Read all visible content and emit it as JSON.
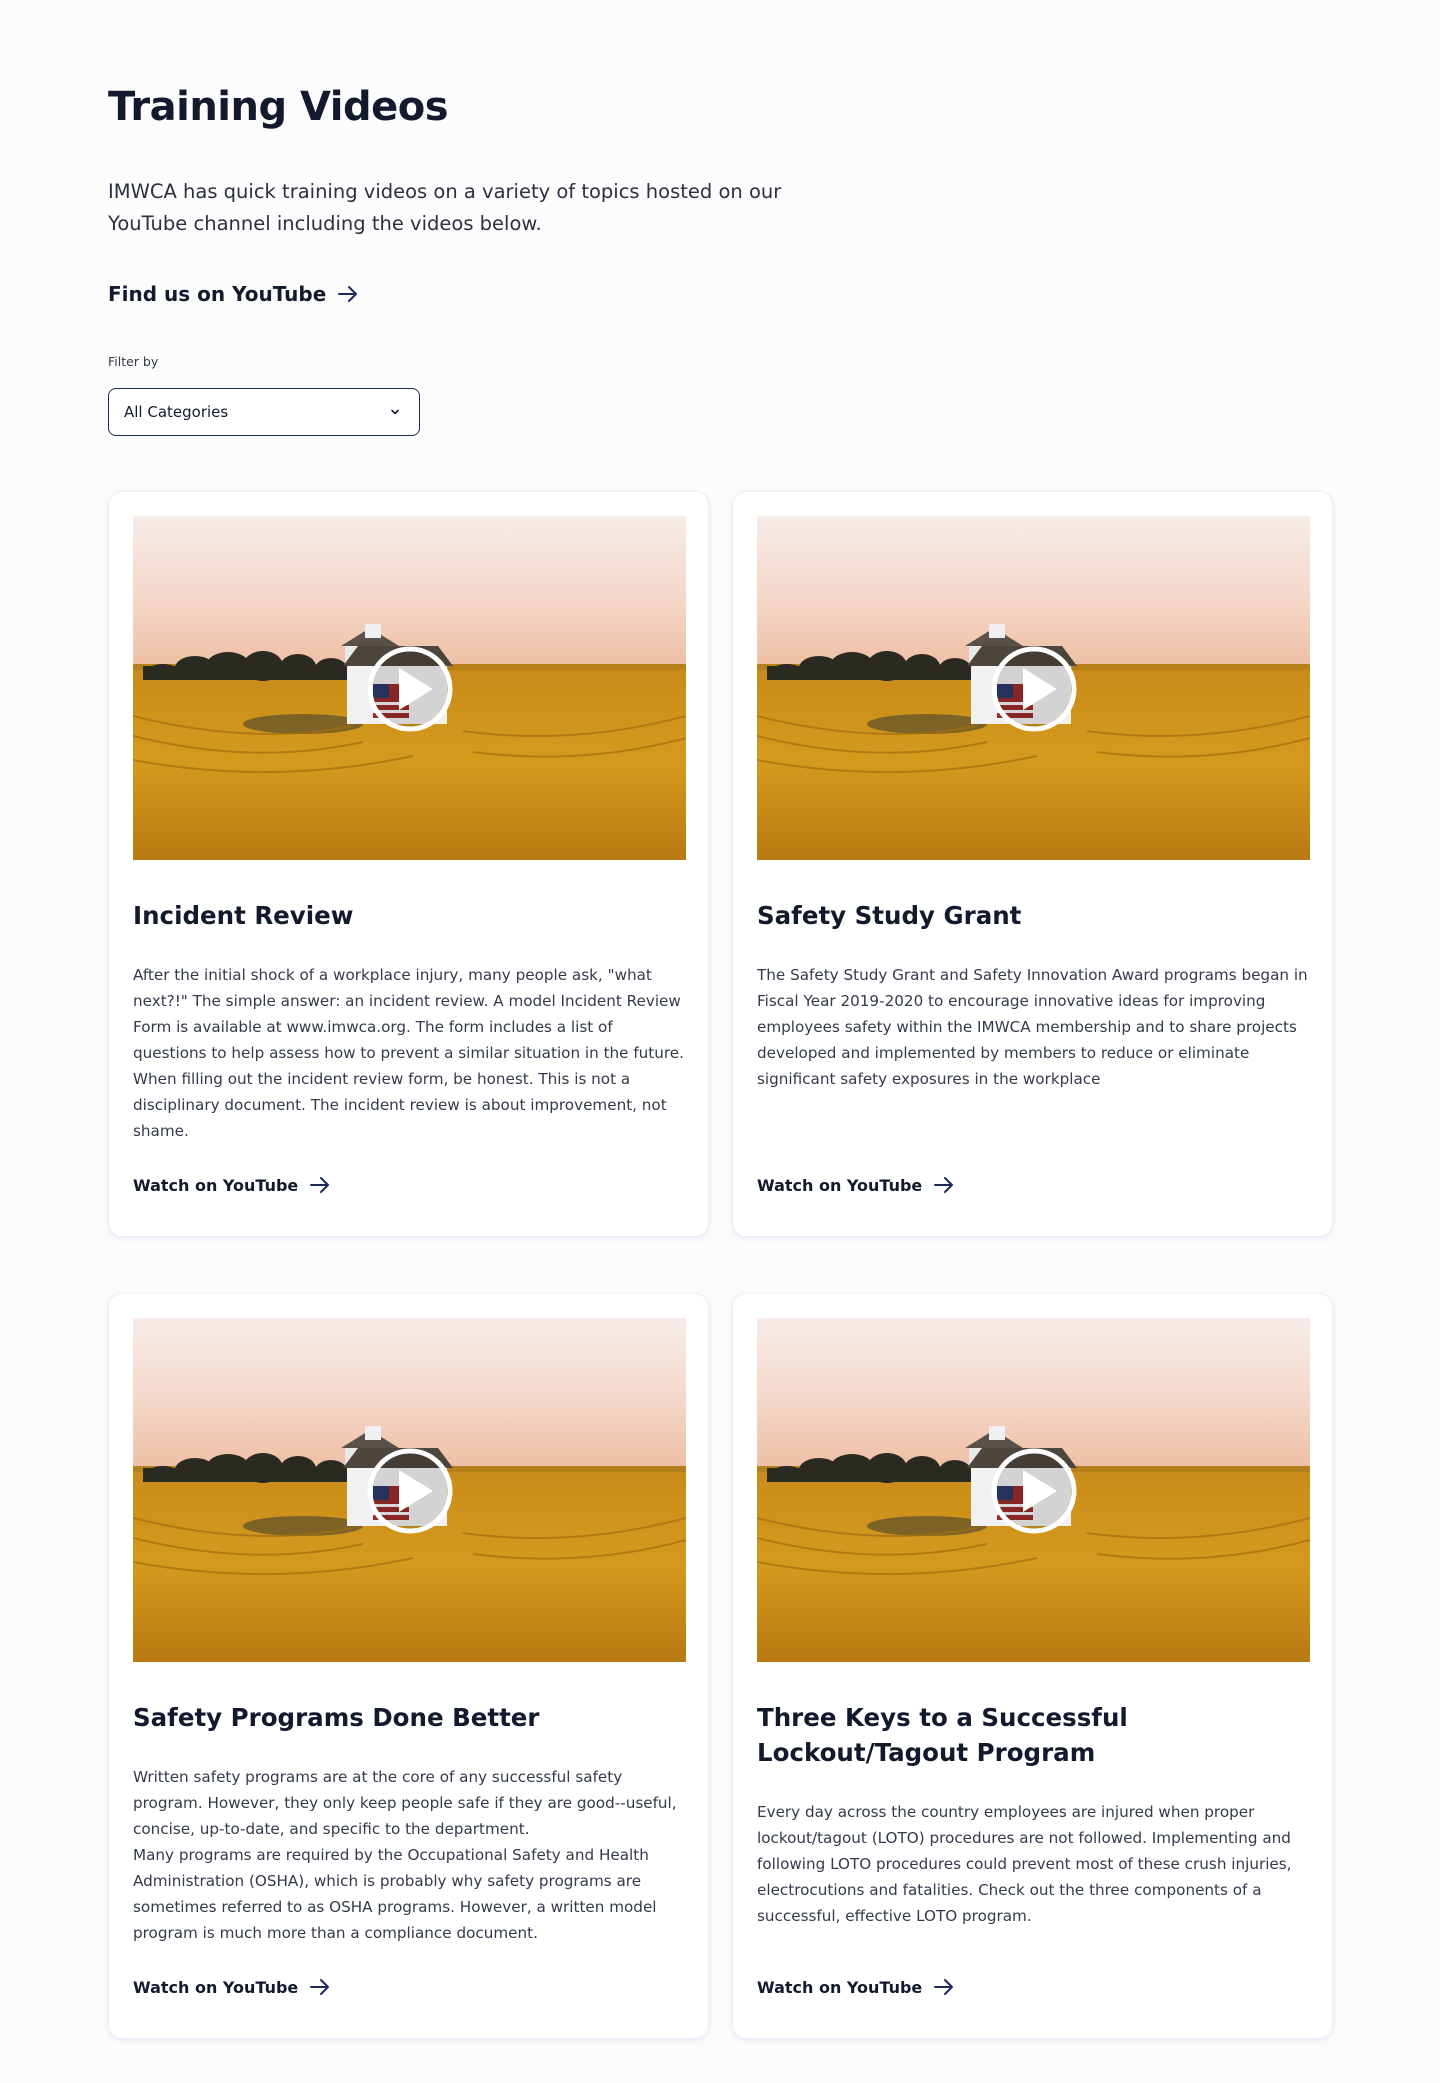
{
  "header": {
    "title": "Training Videos",
    "intro": "IMWCA has quick training videos on a variety of topics hosted on our YouTube channel including the videos below.",
    "youtube_link": "Find us on YouTube"
  },
  "filter": {
    "label": "Filter by",
    "selected": "All Categories"
  },
  "colors": {
    "navy": "#1c2a5c",
    "text": "#131a2e",
    "field": "#d49a1c"
  },
  "videos": [
    {
      "title": "Incident Review",
      "description": "After the initial shock of a workplace injury, many people ask, \"what next?!\" The simple answer: an incident review. A model Incident Review Form is available at www.imwca.org. The form includes a list of questions to help assess how to prevent a similar situation in the future. When filling out the incident review form, be honest. This is not a disciplinary document. The incident review is about improvement, not shame.",
      "link": "Watch on YouTube"
    },
    {
      "title": "Safety Study Grant",
      "description": "The Safety Study Grant and Safety Innovation Award programs began in Fiscal Year 2019-2020 to encourage innovative ideas for improving employees safety within the IMWCA membership and to share projects developed and implemented by members to reduce or eliminate significant safety exposures in the workplace",
      "link": "Watch on YouTube"
    },
    {
      "title": "Safety Programs Done Better",
      "description": "Written safety programs are at the core of any successful safety program. However, they only keep people safe if they are good--useful, concise, up-to-date, and specific to the department.\nMany programs are required by the Occupational Safety and Health Administration (OSHA), which is probably why safety programs are sometimes referred to as OSHA programs. However, a written model program is much more than a compliance document.",
      "link": "Watch on YouTube"
    },
    {
      "title": "Three Keys to a Successful Lockout/Tagout Program",
      "description": "Every day across the country employees are injured when proper lockout/tagout (LOTO) procedures are not followed. Implementing and following LOTO procedures could prevent most of these crush injuries, electrocutions and fatalities. Check out the three components of a successful, effective LOTO program.",
      "link": "Watch on YouTube"
    }
  ]
}
